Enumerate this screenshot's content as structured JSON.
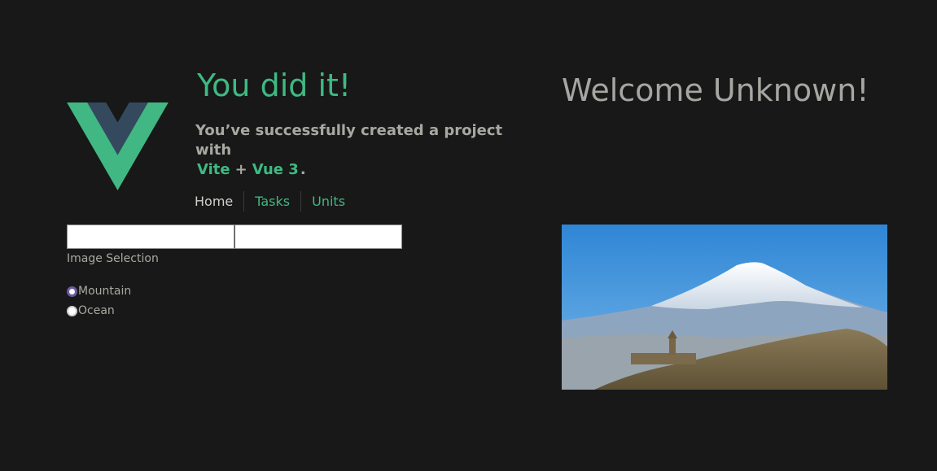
{
  "hero": {
    "title": "You did it!",
    "subtitle_prefix": "You’ve successfully created a project with",
    "link_vite": "Vite",
    "plus": "+",
    "link_vue": "Vue 3",
    "period": "."
  },
  "nav": {
    "items": [
      "Home",
      "Tasks",
      "Units"
    ]
  },
  "form": {
    "input1_value": "",
    "input2_value": "",
    "selection_label": "Image Selection",
    "options": [
      "Mountain",
      "Ocean"
    ],
    "selected": "Mountain"
  },
  "welcome": "Welcome Unknown!",
  "colors": {
    "accent": "#3eb982",
    "background": "#181818",
    "muted_text": "#a8a8a3"
  }
}
